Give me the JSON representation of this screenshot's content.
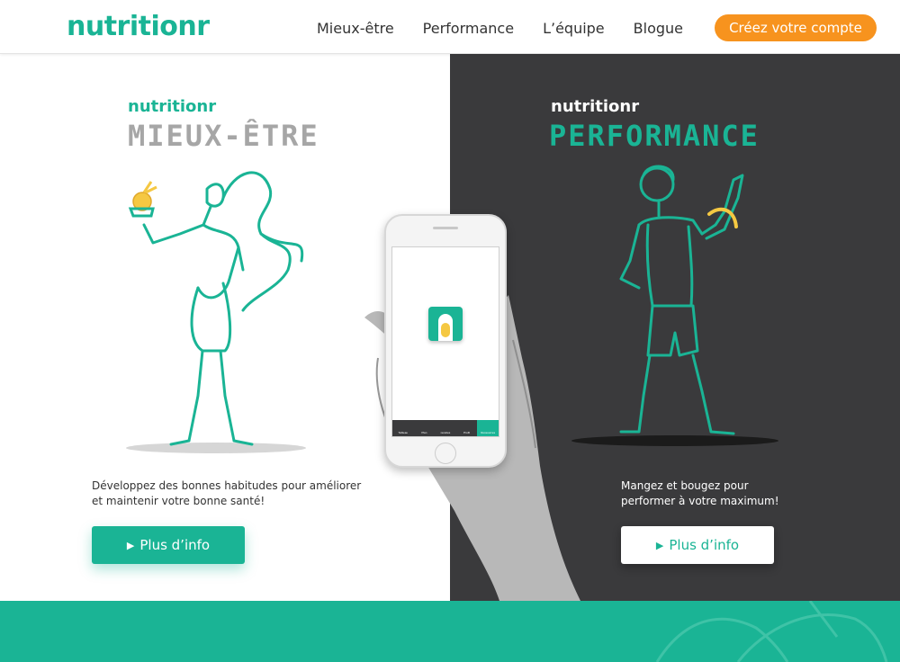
{
  "header": {
    "logo": "nutritionr",
    "nav": [
      "Mieux-être",
      "Performance",
      "L’équipe",
      "Blogue"
    ],
    "cta_label": "Créez votre compte"
  },
  "left": {
    "brand": "nutritionr",
    "title": "MIEUX-ÊTRE",
    "description_line1": "Développez des bonnes habitudes pour améliorer",
    "description_line2": "et maintenir votre bonne santé!",
    "button_label": "Plus d’info"
  },
  "right": {
    "brand": "nutritionr",
    "title": "PERFORMANCE",
    "description_line1": "Mangez et bougez pour",
    "description_line2": "performer à votre maximum!",
    "button_label": "Plus d’info"
  },
  "phone": {
    "tabs": [
      "Tableau",
      "Plan",
      "recettes",
      "Profil",
      "Ressources"
    ],
    "active_tab": "Ressources"
  },
  "colors": {
    "accent": "#1ab495",
    "cta": "#f7931e",
    "dark_panel": "#3a3a3c",
    "yellow": "#f5c842"
  }
}
